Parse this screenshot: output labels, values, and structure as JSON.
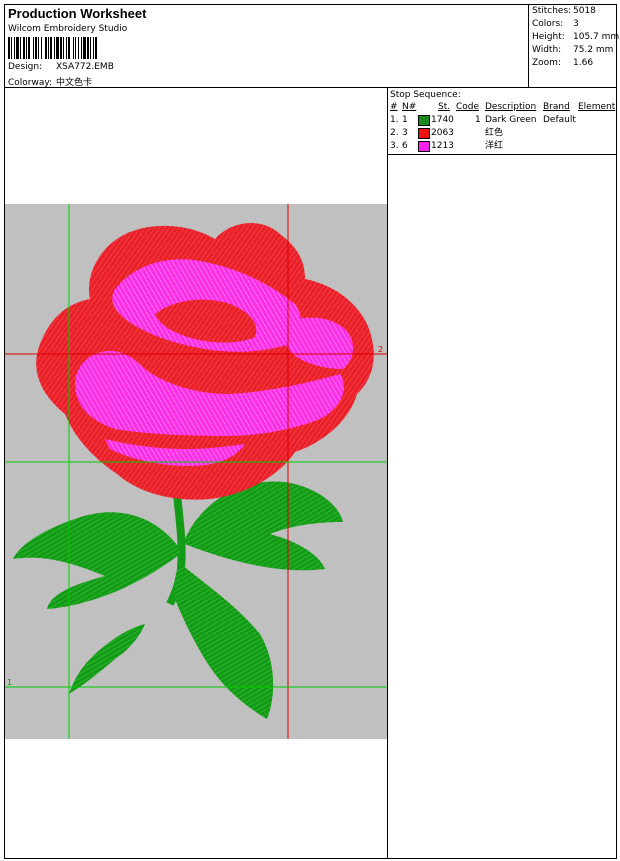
{
  "header": {
    "title": "Production Worksheet",
    "company": "Wilcom Embroidery Studio",
    "design_label": "Design:",
    "design_value": "XSA772.EMB",
    "colorway_label": "Colorway:",
    "colorway_value": "中文色卡"
  },
  "stats": [
    {
      "label": "Stitches:",
      "value": "5018"
    },
    {
      "label": "Colors:",
      "value": "3"
    },
    {
      "label": "Height:",
      "value": "105.7 mm"
    },
    {
      "label": "Width:",
      "value": "75.2 mm"
    },
    {
      "label": "Zoom:",
      "value": "1.66"
    }
  ],
  "stop_sequence": {
    "label": "Stop Sequence:",
    "columns": {
      "num": "#",
      "needle": "N#",
      "st": "St.",
      "code": "Code",
      "description": "Description",
      "brand": "Brand",
      "element": "Element"
    },
    "rows": [
      {
        "num": "1.",
        "needle": "1",
        "color": "#1a8a1a",
        "st": "1740",
        "code": "1",
        "description": "Dark Green",
        "brand": "Default",
        "element": ""
      },
      {
        "num": "2.",
        "needle": "3",
        "color": "#ee1111",
        "st": "2063",
        "code": "",
        "description": "红色",
        "brand": "",
        "element": ""
      },
      {
        "num": "3.",
        "needle": "6",
        "color": "#ff22ee",
        "st": "1213",
        "code": "",
        "description": "洋红",
        "brand": "",
        "element": ""
      }
    ]
  },
  "design_preview": {
    "background": "#c0c0c0",
    "guide_green": "#00cc00",
    "guide_red": "#dd0000",
    "marker_1": "1",
    "marker_2": "2",
    "image_subject": "embroidered rose with green leaves"
  }
}
